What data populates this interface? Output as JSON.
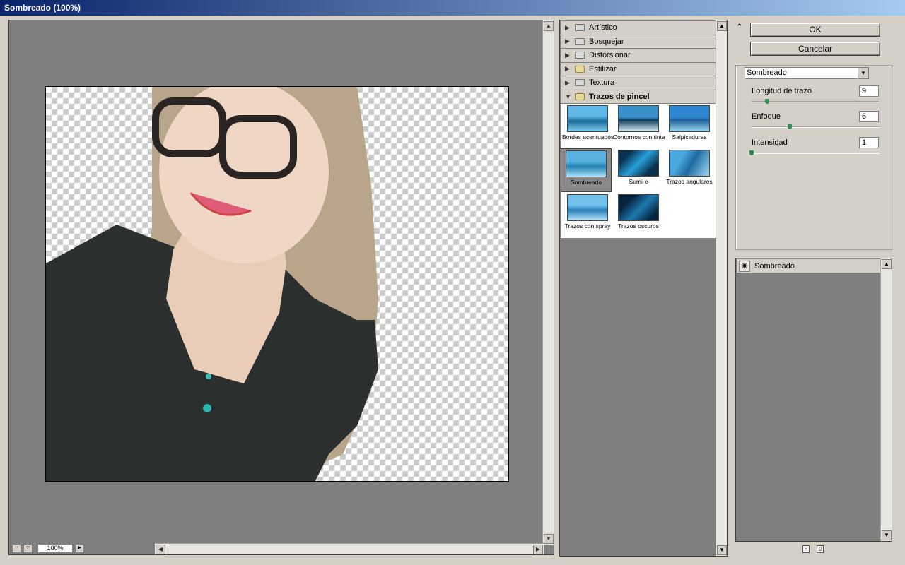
{
  "window": {
    "title": "Sombreado (100%)"
  },
  "preview": {
    "zoom": "100%",
    "zoom_out": "−",
    "zoom_in": "+",
    "zoom_menu": "▸"
  },
  "gallery": {
    "categories": [
      {
        "label": "Artístico",
        "expanded": false
      },
      {
        "label": "Bosquejar",
        "expanded": false
      },
      {
        "label": "Distorsionar",
        "expanded": false
      },
      {
        "label": "Estilizar",
        "expanded": false
      },
      {
        "label": "Textura",
        "expanded": false
      },
      {
        "label": "Trazos de pincel",
        "expanded": true
      }
    ],
    "filters": [
      {
        "label": "Bordes acentuados"
      },
      {
        "label": "Contornos con tinta"
      },
      {
        "label": "Salpicaduras"
      },
      {
        "label": "Sombreado",
        "selected": true
      },
      {
        "label": "Sumi-e"
      },
      {
        "label": "Trazos angulares"
      },
      {
        "label": "Trazos con spray"
      },
      {
        "label": "Trazos oscuros"
      }
    ]
  },
  "actions": {
    "ok": "OK",
    "cancel": "Cancelar",
    "collapse": "⌃"
  },
  "settings": {
    "filter_select": "Sombreado",
    "params": [
      {
        "label": "Longitud de trazo",
        "value": "9",
        "fraction": 0.12
      },
      {
        "label": "Enfoque",
        "value": "6",
        "fraction": 0.3
      },
      {
        "label": "Intensidad",
        "value": "1",
        "fraction": 0.0
      }
    ]
  },
  "layers": [
    {
      "label": "Sombreado"
    }
  ]
}
